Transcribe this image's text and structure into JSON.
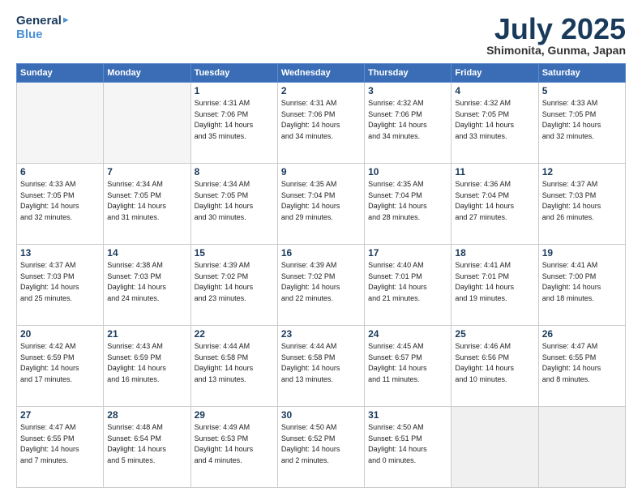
{
  "header": {
    "logo_line1": "General",
    "logo_line2": "Blue",
    "month": "July 2025",
    "location": "Shimonita, Gunma, Japan"
  },
  "weekdays": [
    "Sunday",
    "Monday",
    "Tuesday",
    "Wednesday",
    "Thursday",
    "Friday",
    "Saturday"
  ],
  "weeks": [
    [
      {
        "day": "",
        "detail": ""
      },
      {
        "day": "",
        "detail": ""
      },
      {
        "day": "1",
        "detail": "Sunrise: 4:31 AM\nSunset: 7:06 PM\nDaylight: 14 hours\nand 35 minutes."
      },
      {
        "day": "2",
        "detail": "Sunrise: 4:31 AM\nSunset: 7:06 PM\nDaylight: 14 hours\nand 34 minutes."
      },
      {
        "day": "3",
        "detail": "Sunrise: 4:32 AM\nSunset: 7:06 PM\nDaylight: 14 hours\nand 34 minutes."
      },
      {
        "day": "4",
        "detail": "Sunrise: 4:32 AM\nSunset: 7:05 PM\nDaylight: 14 hours\nand 33 minutes."
      },
      {
        "day": "5",
        "detail": "Sunrise: 4:33 AM\nSunset: 7:05 PM\nDaylight: 14 hours\nand 32 minutes."
      }
    ],
    [
      {
        "day": "6",
        "detail": "Sunrise: 4:33 AM\nSunset: 7:05 PM\nDaylight: 14 hours\nand 32 minutes."
      },
      {
        "day": "7",
        "detail": "Sunrise: 4:34 AM\nSunset: 7:05 PM\nDaylight: 14 hours\nand 31 minutes."
      },
      {
        "day": "8",
        "detail": "Sunrise: 4:34 AM\nSunset: 7:05 PM\nDaylight: 14 hours\nand 30 minutes."
      },
      {
        "day": "9",
        "detail": "Sunrise: 4:35 AM\nSunset: 7:04 PM\nDaylight: 14 hours\nand 29 minutes."
      },
      {
        "day": "10",
        "detail": "Sunrise: 4:35 AM\nSunset: 7:04 PM\nDaylight: 14 hours\nand 28 minutes."
      },
      {
        "day": "11",
        "detail": "Sunrise: 4:36 AM\nSunset: 7:04 PM\nDaylight: 14 hours\nand 27 minutes."
      },
      {
        "day": "12",
        "detail": "Sunrise: 4:37 AM\nSunset: 7:03 PM\nDaylight: 14 hours\nand 26 minutes."
      }
    ],
    [
      {
        "day": "13",
        "detail": "Sunrise: 4:37 AM\nSunset: 7:03 PM\nDaylight: 14 hours\nand 25 minutes."
      },
      {
        "day": "14",
        "detail": "Sunrise: 4:38 AM\nSunset: 7:03 PM\nDaylight: 14 hours\nand 24 minutes."
      },
      {
        "day": "15",
        "detail": "Sunrise: 4:39 AM\nSunset: 7:02 PM\nDaylight: 14 hours\nand 23 minutes."
      },
      {
        "day": "16",
        "detail": "Sunrise: 4:39 AM\nSunset: 7:02 PM\nDaylight: 14 hours\nand 22 minutes."
      },
      {
        "day": "17",
        "detail": "Sunrise: 4:40 AM\nSunset: 7:01 PM\nDaylight: 14 hours\nand 21 minutes."
      },
      {
        "day": "18",
        "detail": "Sunrise: 4:41 AM\nSunset: 7:01 PM\nDaylight: 14 hours\nand 19 minutes."
      },
      {
        "day": "19",
        "detail": "Sunrise: 4:41 AM\nSunset: 7:00 PM\nDaylight: 14 hours\nand 18 minutes."
      }
    ],
    [
      {
        "day": "20",
        "detail": "Sunrise: 4:42 AM\nSunset: 6:59 PM\nDaylight: 14 hours\nand 17 minutes."
      },
      {
        "day": "21",
        "detail": "Sunrise: 4:43 AM\nSunset: 6:59 PM\nDaylight: 14 hours\nand 16 minutes."
      },
      {
        "day": "22",
        "detail": "Sunrise: 4:44 AM\nSunset: 6:58 PM\nDaylight: 14 hours\nand 13 minutes."
      },
      {
        "day": "23",
        "detail": "Sunrise: 4:44 AM\nSunset: 6:58 PM\nDaylight: 14 hours\nand 13 minutes."
      },
      {
        "day": "24",
        "detail": "Sunrise: 4:45 AM\nSunset: 6:57 PM\nDaylight: 14 hours\nand 11 minutes."
      },
      {
        "day": "25",
        "detail": "Sunrise: 4:46 AM\nSunset: 6:56 PM\nDaylight: 14 hours\nand 10 minutes."
      },
      {
        "day": "26",
        "detail": "Sunrise: 4:47 AM\nSunset: 6:55 PM\nDaylight: 14 hours\nand 8 minutes."
      }
    ],
    [
      {
        "day": "27",
        "detail": "Sunrise: 4:47 AM\nSunset: 6:55 PM\nDaylight: 14 hours\nand 7 minutes."
      },
      {
        "day": "28",
        "detail": "Sunrise: 4:48 AM\nSunset: 6:54 PM\nDaylight: 14 hours\nand 5 minutes."
      },
      {
        "day": "29",
        "detail": "Sunrise: 4:49 AM\nSunset: 6:53 PM\nDaylight: 14 hours\nand 4 minutes."
      },
      {
        "day": "30",
        "detail": "Sunrise: 4:50 AM\nSunset: 6:52 PM\nDaylight: 14 hours\nand 2 minutes."
      },
      {
        "day": "31",
        "detail": "Sunrise: 4:50 AM\nSunset: 6:51 PM\nDaylight: 14 hours\nand 0 minutes."
      },
      {
        "day": "",
        "detail": ""
      },
      {
        "day": "",
        "detail": ""
      }
    ]
  ]
}
